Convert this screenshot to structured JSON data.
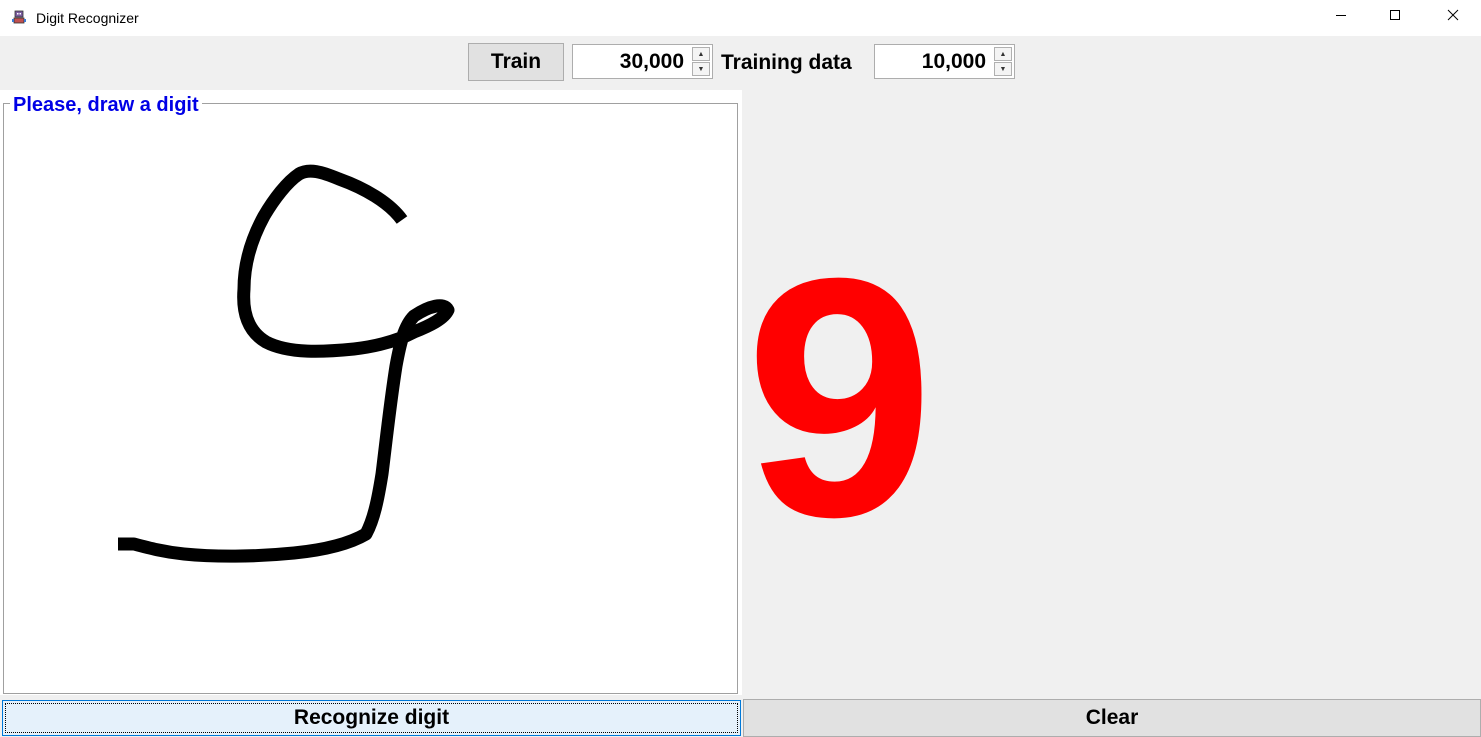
{
  "window": {
    "title": "Digit Recognizer",
    "app_icon": "robot-app-icon",
    "controls": {
      "minimize_icon": "minimize-icon",
      "maximize_icon": "maximize-icon",
      "close_icon": "close-icon"
    }
  },
  "toolbar": {
    "train_label": "Train",
    "iterations_value": "30,000",
    "training_data_label": "Training data",
    "training_data_value": "10,000",
    "spinner_up_icon": "arrow-up-icon",
    "spinner_down_icon": "arrow-down-icon"
  },
  "drawing": {
    "legend": "Please, draw a digit",
    "stroke_color": "#000000",
    "background_color": "#ffffff"
  },
  "result": {
    "digit": "9",
    "color": "#ff0000"
  },
  "actions": {
    "recognize_label": "Recognize digit",
    "clear_label": "Clear"
  }
}
